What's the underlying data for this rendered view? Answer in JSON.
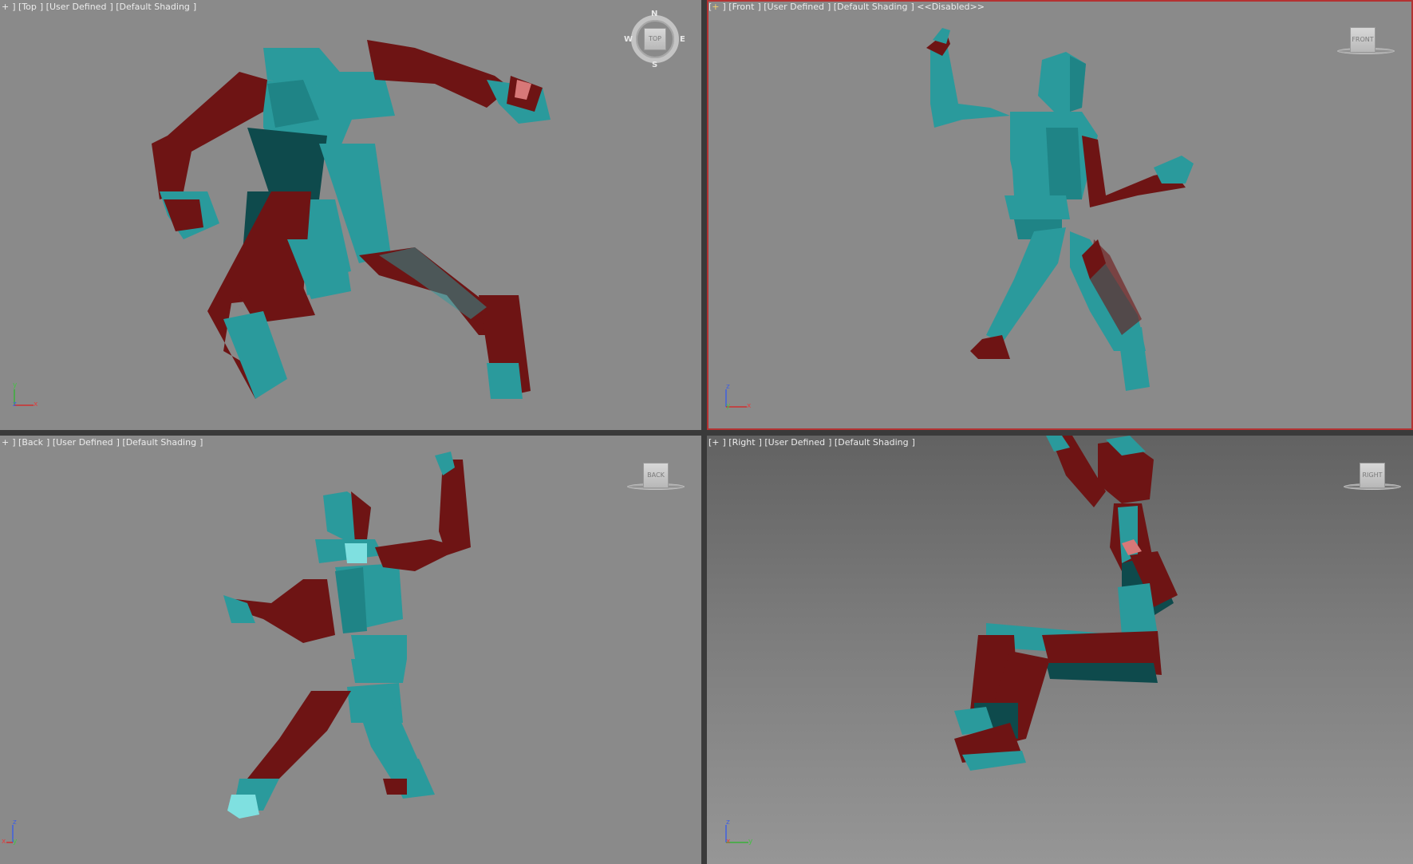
{
  "viewports": {
    "top": {
      "plus": "+",
      "view": "Top",
      "mode": "User Defined",
      "shading": "Default Shading",
      "cube_label": "TOP",
      "compass": {
        "n": "N",
        "s": "S",
        "e": "E",
        "w": "W"
      },
      "axis_v": "y",
      "axis_h": "x",
      "axis_o": "z"
    },
    "front": {
      "plus": "+",
      "view": "Front",
      "mode": "User Defined",
      "shading": "Default Shading",
      "status": "<<Disabled>>",
      "cube_label": "FRONT",
      "axis_v": "z",
      "axis_h": "x",
      "axis_o": "y"
    },
    "back": {
      "plus": "+",
      "view": "Back",
      "mode": "User Defined",
      "shading": "Default Shading",
      "cube_label": "BACK",
      "axis_v": "z",
      "axis_h": "x",
      "axis_o": "y"
    },
    "right": {
      "plus": "+",
      "view": "Right",
      "mode": "User Defined",
      "shading": "Default Shading",
      "cube_label": "RIGHT",
      "axis_v": "z",
      "axis_h": "y",
      "axis_o": "x"
    }
  },
  "colors": {
    "viewport_bg": "#8a8a8a",
    "active_border": "#b43232",
    "teal": "#2a9a9c",
    "teal_dark": "#0e4a4c",
    "teal_light": "#7fe0e0",
    "maroon": "#6e1414",
    "maroon_dark": "#3a0808",
    "pink": "#d87878"
  }
}
